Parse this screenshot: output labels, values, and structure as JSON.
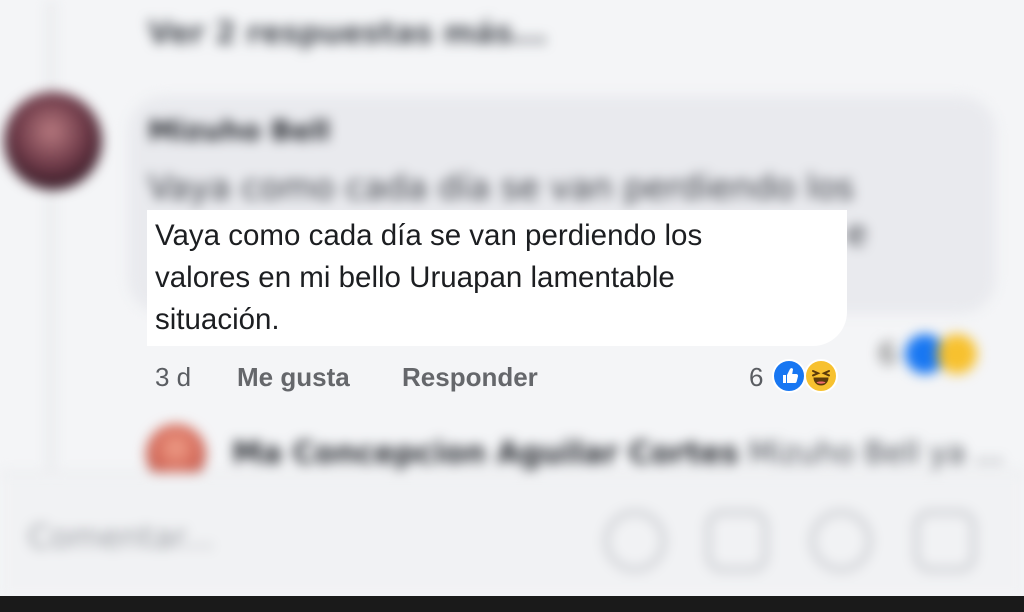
{
  "thread": {
    "more_replies_label": "Ver 2 respuestas más...",
    "comment": {
      "author": "Mizuho Bell",
      "text": "Vaya como cada día se van perdiendo los valores en mi bello Uruapan lamentable situación.",
      "text_lines": [
        "Vaya como cada día se van perdiendo los",
        "valores en mi bello Uruapan lamentable",
        "situación."
      ],
      "bg_text_line": "Vaya como cada día se van perdiendo los",
      "bg_text_tail": "e",
      "time": "3 d",
      "like_label": "Me gusta",
      "reply_label": "Responder",
      "reaction_count": "6",
      "reactions": [
        "like-icon",
        "haha-icon"
      ]
    },
    "reply_preview": {
      "author": "Ma Concepcion Aguilar Cortes",
      "text": "Mizuho Bell ya ..."
    }
  },
  "composer": {
    "placeholder": "Comentar...",
    "icons": [
      "camera-icon",
      "gif-icon",
      "emoji-icon",
      "sticker-icon"
    ]
  },
  "colors": {
    "facebook_blue": "#1877f2",
    "haha_yellow": "#f7c12f",
    "bubble_grey": "#e9eaee"
  }
}
